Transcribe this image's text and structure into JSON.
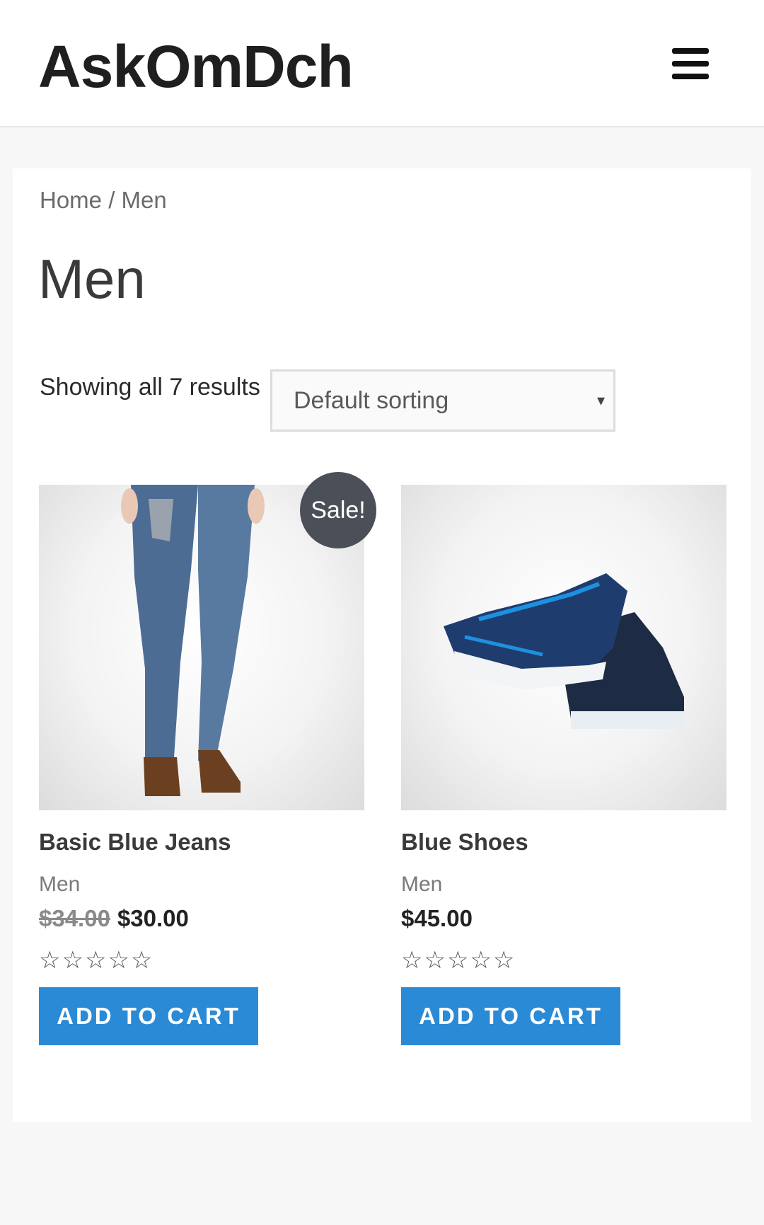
{
  "header": {
    "site_title": "AskOmDch",
    "menu_icon": "hamburger-menu-icon"
  },
  "breadcrumb": {
    "home": "Home",
    "separator": " / ",
    "current": "Men"
  },
  "page_title": "Men",
  "result_count": "Showing all 7 results",
  "ordering": {
    "selected": "Default sorting",
    "caret": "▾"
  },
  "colors": {
    "accent": "#2b8ad6",
    "sale_badge": "#4b4f58"
  },
  "products": [
    {
      "name": "Basic Blue Jeans",
      "category": "Men",
      "regular_price": "$34.00",
      "sale_price": "$30.00",
      "badge": "Sale!",
      "rating_stars": "☆☆☆☆☆",
      "rating_value": 0,
      "button": "ADD TO CART"
    },
    {
      "name": "Blue Shoes",
      "category": "Men",
      "price": "$45.00",
      "rating_stars": "☆☆☆☆☆",
      "rating_value": 0,
      "button": "ADD TO CART"
    }
  ]
}
